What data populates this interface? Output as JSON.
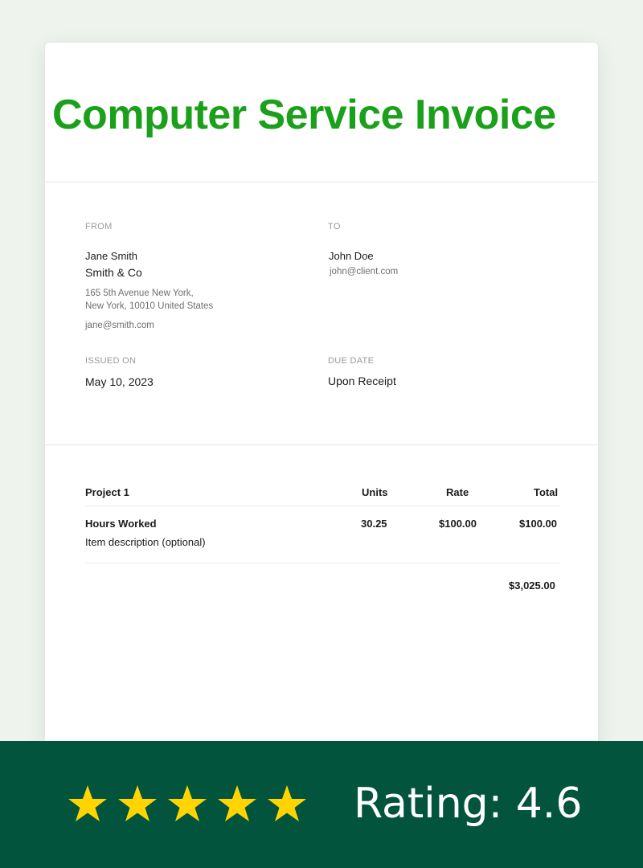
{
  "invoice": {
    "title": "Computer Service Invoice",
    "from": {
      "label": "FROM",
      "name": "Jane Smith",
      "company": "Smith & Co",
      "address_line1": "165 5th Avenue New York,",
      "address_line2": "New York, 10010 United States",
      "email": "jane@smith.com"
    },
    "to": {
      "label": "TO",
      "name": "John Doe",
      "email": "john@client.com"
    },
    "issued": {
      "label": "ISSUED ON",
      "value": "May 10, 2023"
    },
    "due": {
      "label": "DUE DATE",
      "value": "Upon Receipt"
    },
    "table": {
      "headers": {
        "project": "Project 1",
        "units": "Units",
        "rate": "Rate",
        "total": "Total"
      },
      "rows": [
        {
          "item": "Hours Worked",
          "description": "Item description (optional)",
          "units": "30.25",
          "rate": "$100.00",
          "total": "$100.00"
        }
      ],
      "grand_total": "$3,025.00"
    }
  },
  "footer": {
    "stars": 5,
    "star_color": "#ffd400",
    "background": "#03543c",
    "rating_text": "Rating: 4.6"
  },
  "colors": {
    "title": "#1aa01a",
    "page_background": "#eef3ee"
  }
}
